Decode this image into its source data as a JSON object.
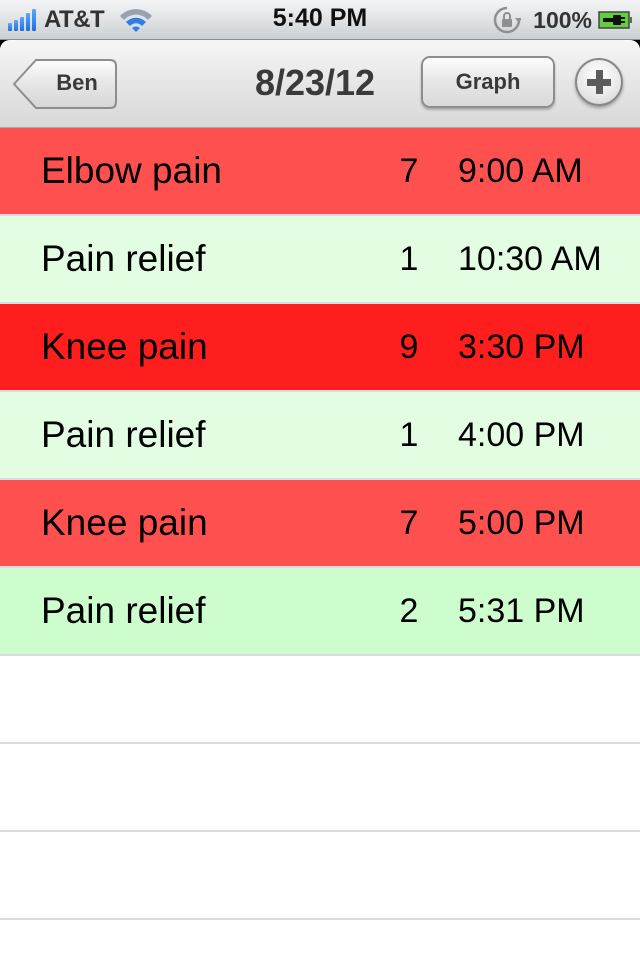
{
  "status_bar": {
    "carrier": "AT&T",
    "time": "5:40 PM",
    "battery_percent": "100%",
    "signal_bars": 5,
    "icons": [
      "signal-bars-icon",
      "wifi-icon",
      "rotation-lock-icon",
      "battery-charging-icon"
    ]
  },
  "navbar": {
    "back_label": "Ben",
    "title": "8/23/12",
    "graph_label": "Graph",
    "add_icon": "plus-icon"
  },
  "colors": {
    "pain_moderate": "#ff5050",
    "pain_severe": "#ff1e1e",
    "relief_light": "#e2fde2",
    "relief_medium": "#cdfdcd",
    "separator": "#dcdcdc"
  },
  "entries": [
    {
      "name": "Elbow pain",
      "level": "7",
      "time": "9:00 AM",
      "color": "#ff5050"
    },
    {
      "name": "Pain relief",
      "level": "1",
      "time": "10:30 AM",
      "color": "#e2fde2"
    },
    {
      "name": "Knee pain",
      "level": "9",
      "time": "3:30 PM",
      "color": "#ff1e1e"
    },
    {
      "name": "Pain relief",
      "level": "1",
      "time": "4:00 PM",
      "color": "#e2fde2"
    },
    {
      "name": "Knee pain",
      "level": "7",
      "time": "5:00 PM",
      "color": "#ff5050"
    },
    {
      "name": "Pain relief",
      "level": "2",
      "time": "5:31 PM",
      "color": "#cdfdcd"
    }
  ]
}
